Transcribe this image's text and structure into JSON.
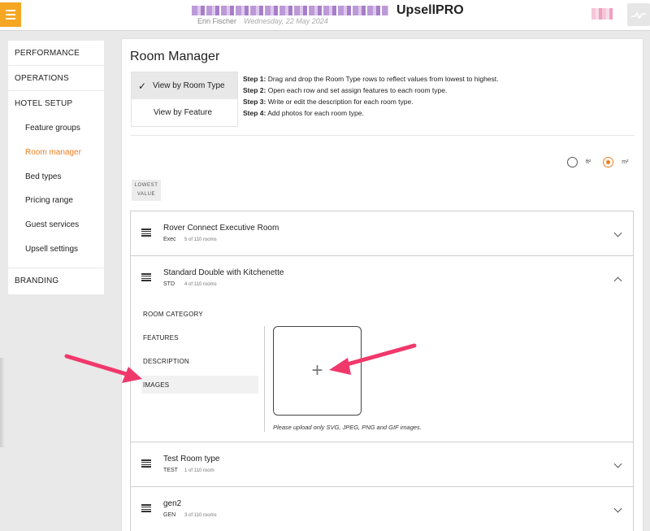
{
  "header": {
    "app_name": "UpsellPRO",
    "user_name": "Erin Fischer",
    "date": "Wednesday, 22 May 2024"
  },
  "sidebar": {
    "sections": [
      {
        "label": "PERFORMANCE"
      },
      {
        "label": "OPERATIONS"
      },
      {
        "label": "HOTEL SETUP"
      }
    ],
    "items": [
      {
        "label": "Feature groups"
      },
      {
        "label": "Room manager"
      },
      {
        "label": "Bed types"
      },
      {
        "label": "Pricing range"
      },
      {
        "label": "Guest services"
      },
      {
        "label": "Upsell settings"
      }
    ],
    "branding": "BRANDING"
  },
  "main": {
    "title": "Room Manager",
    "view_by_room_type": "View by Room Type",
    "view_by_feature": "View by Feature",
    "steps": [
      {
        "label": "Step 1:",
        "text": " Drag and drop the Room Type rows to reflect values from lowest to highest."
      },
      {
        "label": "Step 2:",
        "text": " Open each row and set assign features to each room type."
      },
      {
        "label": "Step 3:",
        "text": " Write or edit the description for each room type."
      },
      {
        "label": "Step 4:",
        "text": " Add photos for each room type."
      }
    ],
    "units": {
      "ft2": "ft²",
      "m2": "m²",
      "selected": "m2"
    },
    "lowest_line1": "LOWEST",
    "lowest_line2": "VALUE"
  },
  "rooms": [
    {
      "name": "Rover Connect Executive Room",
      "code": "Exec",
      "count": "5 of 110 rooms"
    },
    {
      "name": "Standard Double with Kitchenette",
      "code": "STD",
      "count": "4 of 110 rooms"
    },
    {
      "name": "Test Room type",
      "code": "TEST",
      "count": "1 of 110 room"
    },
    {
      "name": "gen2",
      "code": "GEN",
      "count": "3 of 110 rooms"
    }
  ],
  "expanded": {
    "tabs": [
      {
        "label": "ROOM CATEGORY"
      },
      {
        "label": "FEATURES"
      },
      {
        "label": "DESCRIPTION"
      },
      {
        "label": "IMAGES"
      }
    ],
    "active_tab": "IMAGES",
    "upload_symbol": "+",
    "upload_note": "Please upload only SVG, JPEG, PNG and GIF images."
  },
  "colors": {
    "accent": "#f07f1f",
    "annotation": "#f0386b",
    "menu": "#f5a623"
  },
  "icons": [
    "menu-icon",
    "activity-icon",
    "check-icon",
    "drag-handle-icon",
    "chevron-down-icon",
    "chevron-up-icon",
    "plus-icon"
  ]
}
